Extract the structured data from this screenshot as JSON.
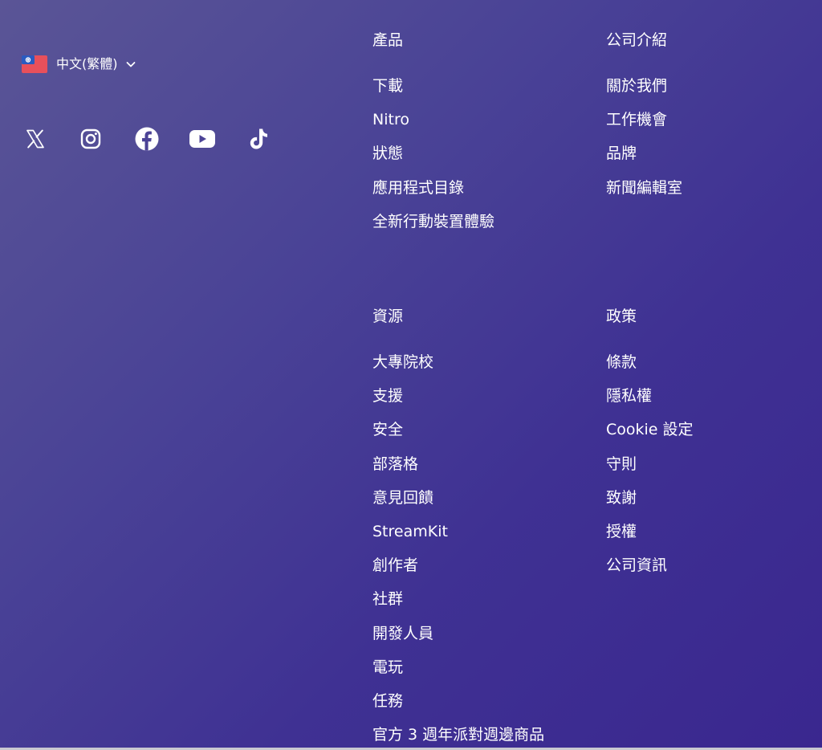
{
  "language": {
    "label": "中文(繁體)",
    "flag_icon": "taiwan-flag-icon",
    "chevron_icon": "chevron-down-icon"
  },
  "social": [
    {
      "name": "X",
      "icon": "x-icon"
    },
    {
      "name": "Instagram",
      "icon": "instagram-icon"
    },
    {
      "name": "Facebook",
      "icon": "facebook-icon"
    },
    {
      "name": "YouTube",
      "icon": "youtube-icon"
    },
    {
      "name": "TikTok",
      "icon": "tiktok-icon"
    }
  ],
  "columns": {
    "products": {
      "heading": "產品",
      "links": [
        "下載",
        "Nitro",
        "狀態",
        "應用程式目錄",
        "全新行動裝置體驗"
      ]
    },
    "company": {
      "heading": "公司介紹",
      "links": [
        "關於我們",
        "工作機會",
        "品牌",
        "新聞編輯室"
      ]
    },
    "resources": {
      "heading": "資源",
      "links": [
        "大專院校",
        "支援",
        "安全",
        "部落格",
        "意見回饋",
        "StreamKit",
        "創作者",
        "社群",
        "開發人員",
        "電玩",
        "任務",
        "官方 3 週年派對週邊商品"
      ]
    },
    "policies": {
      "heading": "政策",
      "links": [
        "條款",
        "隱私權",
        "Cookie 設定",
        "守則",
        "致謝",
        "授權",
        "公司資訊"
      ]
    }
  },
  "colors": {
    "gradient_start": "#5a5596",
    "gradient_end": "#3a278f",
    "text": "#ffffff",
    "flag_red": "#e8505b",
    "flag_blue": "#1f4fb3"
  }
}
